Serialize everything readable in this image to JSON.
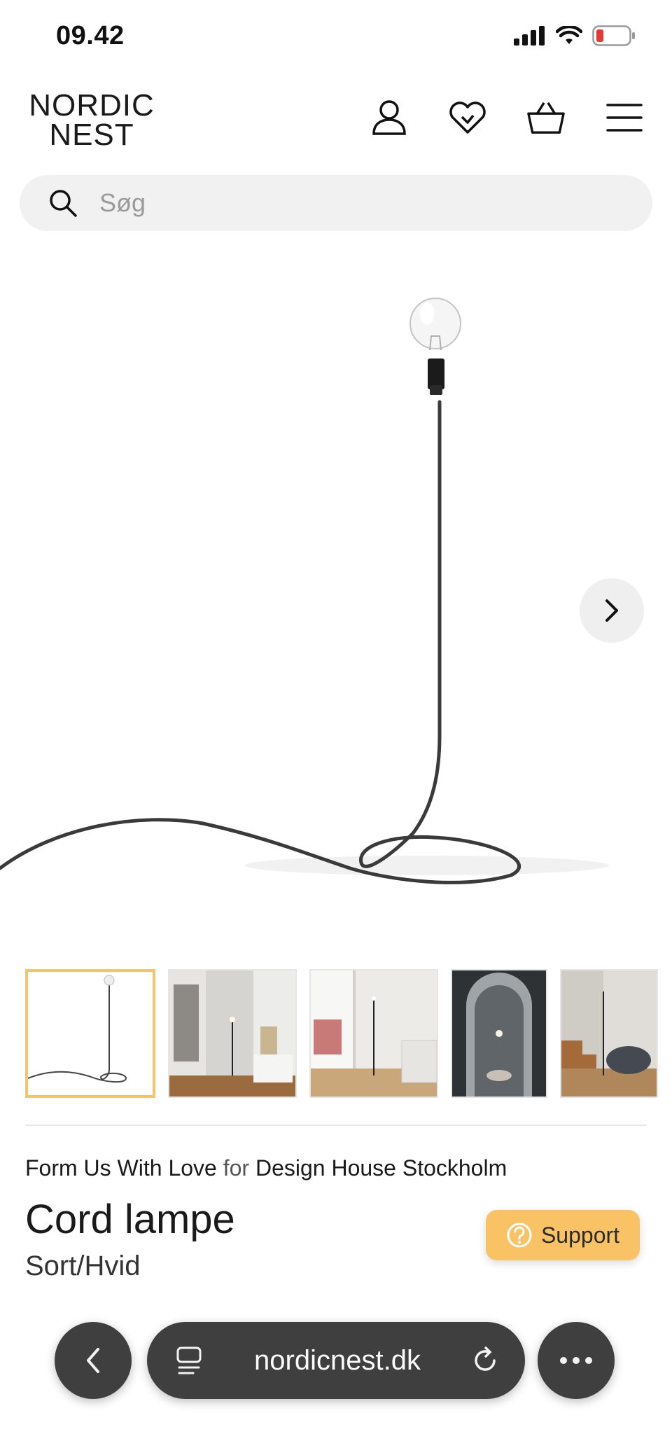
{
  "status": {
    "time": "09.42",
    "icons": [
      "cellular-signal-icon",
      "wifi-icon",
      "battery-low-icon"
    ],
    "battery_color": "#e53935"
  },
  "header": {
    "logo_line1": "NORDIC",
    "logo_line2": "NEST",
    "icons": [
      "account-icon",
      "wishlist-heart-icon",
      "basket-icon",
      "menu-icon"
    ]
  },
  "search": {
    "placeholder": "Søg",
    "icon": "search-icon"
  },
  "gallery": {
    "thumbnail_count": 5,
    "active_index": 0,
    "active_border_color": "#f4c46a",
    "next_icon": "chevron-right-icon"
  },
  "product": {
    "designer": "Form Us With Love",
    "for_word": "for",
    "brand": "Design House Stockholm",
    "name": "Cord lampe",
    "variant": "Sort/Hvid"
  },
  "support": {
    "label": "Support",
    "icon": "help-circle-icon",
    "color": "#f9c365"
  },
  "browser": {
    "url": "nordicnest.dk",
    "icons": [
      "back-chevron-icon",
      "tabs-icon",
      "reload-icon",
      "more-dots-icon"
    ]
  }
}
